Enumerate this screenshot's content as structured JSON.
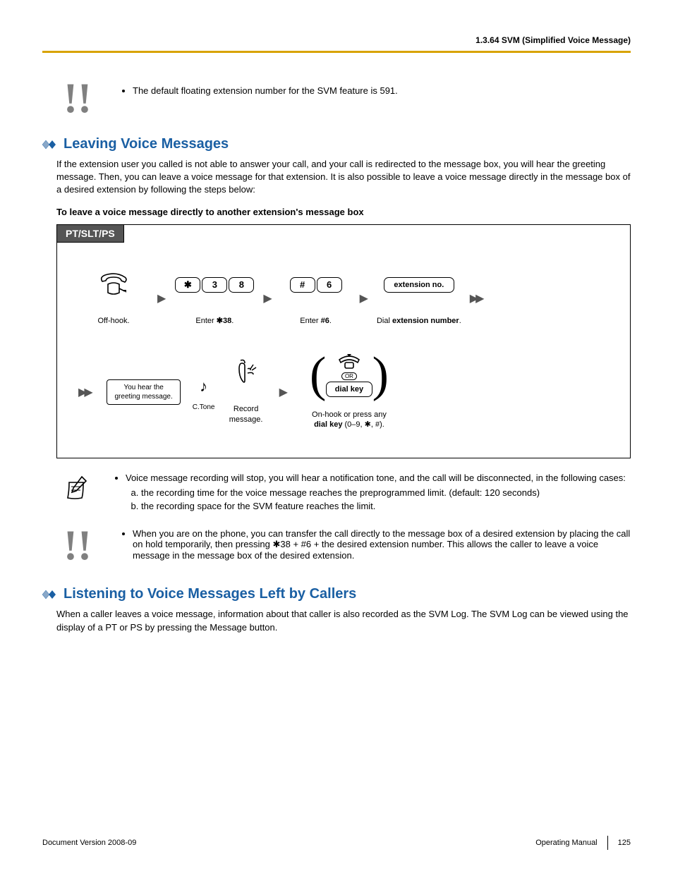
{
  "header": {
    "section_ref": "1.3.64 SVM (Simplified Voice Message)"
  },
  "top_note": {
    "bullet": "The default floating extension number for the SVM feature is 591."
  },
  "section1": {
    "title": "Leaving Voice Messages",
    "intro": "If the extension user you called is not able to answer your call, and your call is redirected to the message box, you will hear the greeting message. Then, you can leave a voice message for that extension. It is also possible to leave a voice message directly in the message box of a desired extension by following the steps below:",
    "subhead": "To leave a voice message directly to another extension's message box",
    "tab": "PT/SLT/PS",
    "flow": {
      "offhook": "Off-hook.",
      "enter38_pre": "Enter ",
      "enter38_code": "✱38",
      "enter38_post": ".",
      "keys38": [
        "✱",
        "3",
        "8"
      ],
      "enter6_pre": "Enter ",
      "enter6_code": "#6",
      "enter6_post": ".",
      "keys6": [
        "#",
        "6"
      ],
      "ext_key": "extension no.",
      "ext_caption_pre": "Dial ",
      "ext_caption_bold": "extension number",
      "ext_caption_post": ".",
      "greet_l1": "You hear the",
      "greet_l2": "greeting message.",
      "ctone": "C.Tone",
      "record_l1": "Record",
      "record_l2": "message.",
      "or": "OR",
      "dialkey": "dial key",
      "onhook_l1": "On-hook or press any",
      "onhook_l2a": "dial key",
      "onhook_l2b": " (0–9, ✱, #)."
    },
    "note1": {
      "lead": "Voice message recording will stop, you will hear a notification tone, and the call will be disconnected, in the following cases:",
      "a": "the recording time for the voice message reaches the preprogrammed limit. (default: 120 seconds)",
      "b": "the recording space for the SVM feature reaches the limit."
    },
    "note2": "When you are on the phone, you can transfer the call directly to the message box of a desired extension by placing the call on hold temporarily, then pressing ✱38 + #6 + the desired extension number. This allows the caller to leave a voice message in the message box of the desired extension."
  },
  "section2": {
    "title": "Listening to Voice Messages Left by Callers",
    "intro": "When a caller leaves a voice message, information about that caller is also recorded as the SVM Log. The SVM Log can be viewed using the display of a PT or PS by pressing the Message button."
  },
  "footer": {
    "doc_version": "Document Version  2008-09",
    "manual": "Operating Manual",
    "page": "125"
  }
}
